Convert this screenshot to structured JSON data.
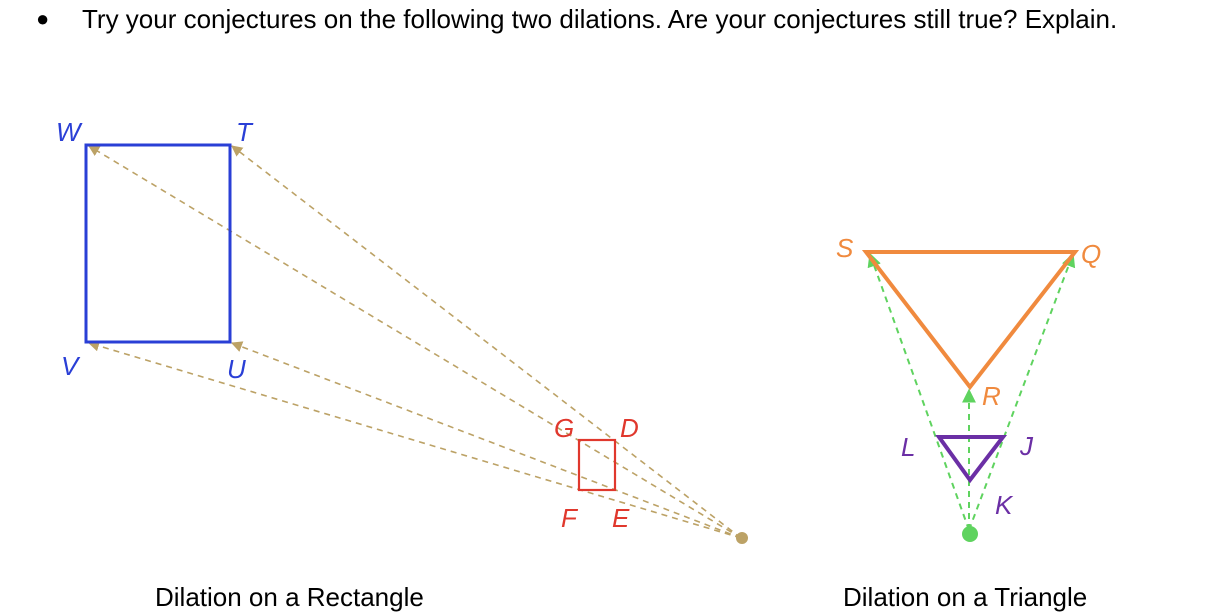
{
  "prompt": {
    "bullet": "●",
    "text": "Try your conjectures on the following two dilations. Are your conjectures still true? Explain."
  },
  "colors": {
    "rect_original": "#2a3fd6",
    "rect_image": "#e0382d",
    "rect_rays": "#bca266",
    "rect_center": "#bca266",
    "tri_original": "#f08a3e",
    "tri_image": "#6b2fa5",
    "tri_rays": "#5fd35f",
    "tri_center": "#5fd35f"
  },
  "rectangle_dilation": {
    "caption": "Dilation on a Rectangle",
    "original_labels": {
      "W": "W",
      "T": "T",
      "U": "U",
      "V": "V"
    },
    "image_labels": {
      "G": "G",
      "D": "D",
      "E": "E",
      "F": "F"
    }
  },
  "triangle_dilation": {
    "caption": "Dilation on a Triangle",
    "original_labels": {
      "S": "S",
      "Q": "Q",
      "R": "R"
    },
    "image_labels": {
      "L": "L",
      "J": "J",
      "K": "K"
    }
  }
}
